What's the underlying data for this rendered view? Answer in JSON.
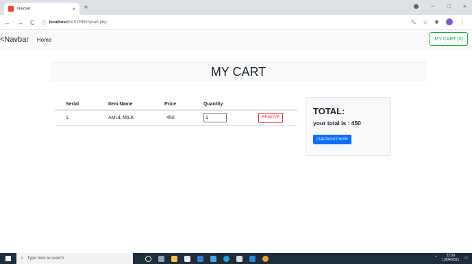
{
  "browser": {
    "tab_title": "Navbar",
    "tab_close": "×",
    "new_tab": "+",
    "url_host": "localhost",
    "url_path": "/EASYRR/mycart.php",
    "back": "←",
    "forward": "→",
    "reload": "C",
    "info_icon": "ⓘ",
    "zoom_icon": "🔍",
    "star_icon": "☆",
    "ext_icon": "✱",
    "menu_icon": "⋮",
    "minimize": "−",
    "maximize": "□",
    "close": "×"
  },
  "navbar": {
    "brand": "<Navbar",
    "home": "Home",
    "cart_button": "MY CART (0)"
  },
  "hero": {
    "title": "MY CART"
  },
  "table": {
    "headers": [
      "Serial",
      "Item Name",
      "Price",
      "Quantity",
      ""
    ],
    "rows": [
      {
        "serial": "1",
        "item": "AMUL MILK",
        "price": "450",
        "quantity": "1",
        "action": "REMOVE"
      }
    ]
  },
  "summary": {
    "title": "TOTAL:",
    "total_line": "your total is : 450",
    "checkout": "CHECKOUT NOW"
  },
  "taskbar": {
    "search_placeholder": "Type here to search",
    "time": "22:30",
    "date": "13/04/2021"
  }
}
